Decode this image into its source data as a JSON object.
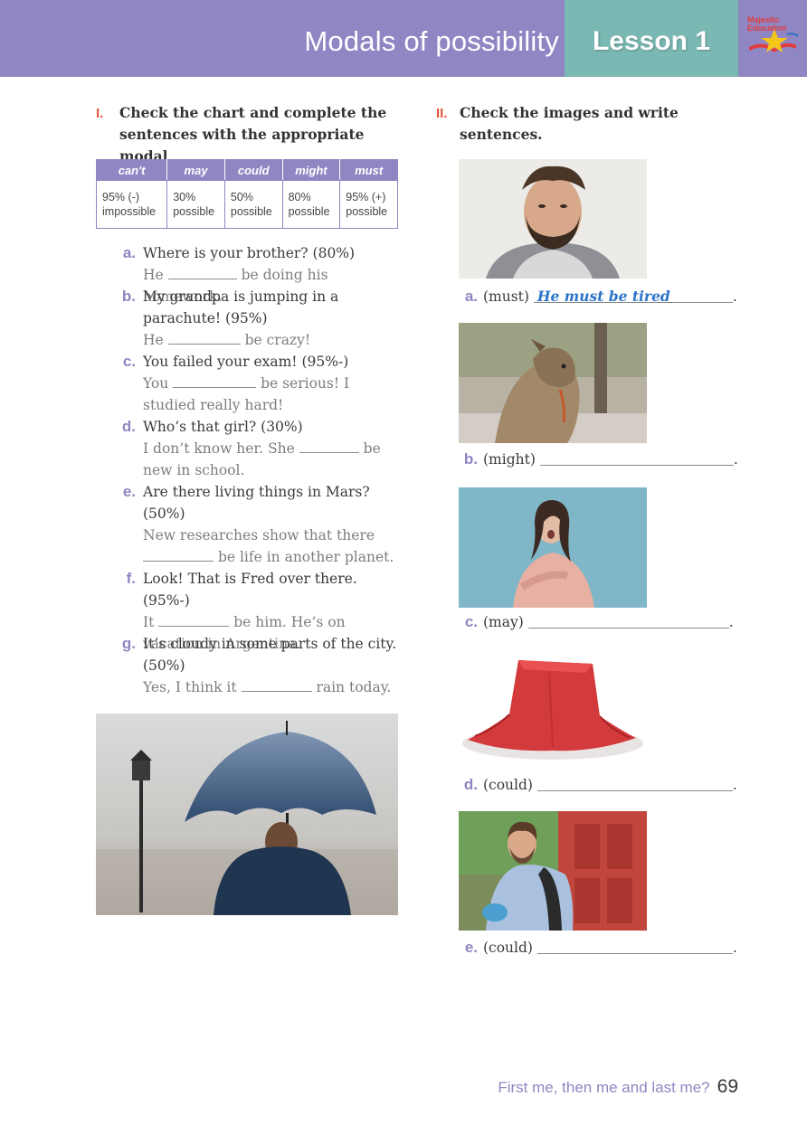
{
  "header": {
    "topic": "Modals of possibility",
    "lesson": "Lesson 1",
    "logo_text": "Majestic Education"
  },
  "section1": {
    "number": "I.",
    "title": "Check the chart and complete the sentences with the appropriate modal",
    "chart": {
      "headers": [
        "can't",
        "may",
        "could",
        "might",
        "must"
      ],
      "cells": [
        [
          "95% (-)",
          "impossible"
        ],
        [
          "30%",
          "possible"
        ],
        [
          "50%",
          "possible"
        ],
        [
          "80%",
          "possible"
        ],
        [
          "95% (+)",
          "possible"
        ]
      ]
    },
    "items": [
      {
        "letter": "a.",
        "q": "Where is your brother? (80%)",
        "a1": "He",
        "a2": "be doing his homework."
      },
      {
        "letter": "b.",
        "q": "My grandpa is jumping in a parachute! (95%)",
        "a1": "He",
        "a2": "be crazy!"
      },
      {
        "letter": "c.",
        "q": "You failed your exam! (95%-)",
        "a1": "You",
        "a2": "be serious! I studied really hard!"
      },
      {
        "letter": "d.",
        "q": "Who’s that girl? (30%)",
        "a1": "I don’t know her. She",
        "a2": "be new in school."
      },
      {
        "letter": "e.",
        "q": "Are there living things in Mars? (50%)",
        "a1": "New researches show that there",
        "a2": "be life in another planet."
      },
      {
        "letter": "f.",
        "q": "Look! That is Fred over there. (95%-)",
        "a1": "It",
        "a2": "be him. He’s on vacation in Argentina."
      },
      {
        "letter": "g.",
        "q": "It’s cloudy in some parts of the city. (50%)",
        "a1": "Yes, I think it",
        "a2": "rain today."
      }
    ]
  },
  "section2": {
    "number": "II.",
    "title": "Check the images and write sentences.",
    "items": [
      {
        "letter": "a.",
        "modal": "(must)",
        "answer": "He must be tired"
      },
      {
        "letter": "b.",
        "modal": "(might)",
        "answer": ""
      },
      {
        "letter": "c.",
        "modal": "(may)",
        "answer": ""
      },
      {
        "letter": "d.",
        "modal": "(could)",
        "answer": ""
      },
      {
        "letter": "e.",
        "modal": "(could)",
        "answer": ""
      }
    ]
  },
  "footer": {
    "tagline": "First me, then me and last me?",
    "page": "69"
  }
}
